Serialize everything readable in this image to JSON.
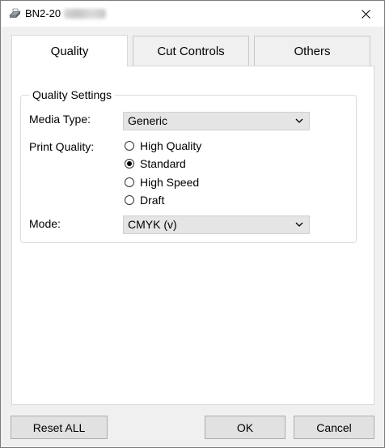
{
  "window": {
    "title": "BN2-20",
    "close_symbol": "✕"
  },
  "tabs": [
    {
      "label": "Quality",
      "active": true
    },
    {
      "label": "Cut Controls",
      "active": false
    },
    {
      "label": "Others",
      "active": false
    }
  ],
  "quality_settings": {
    "group_title": "Quality Settings",
    "media_type": {
      "label": "Media Type:",
      "value": "Generic"
    },
    "print_quality": {
      "label": "Print Quality:",
      "options": [
        {
          "label": "High Quality",
          "selected": false
        },
        {
          "label": "Standard",
          "selected": true
        },
        {
          "label": "High Speed",
          "selected": false
        },
        {
          "label": "Draft",
          "selected": false
        }
      ]
    },
    "mode": {
      "label": "Mode:",
      "value": "CMYK (v)"
    }
  },
  "buttons": {
    "reset_all": "Reset ALL",
    "ok": "OK",
    "cancel": "Cancel"
  },
  "icons": {
    "app": "printer-icon",
    "close": "close-icon",
    "dropdown": "chevron-down-icon"
  }
}
